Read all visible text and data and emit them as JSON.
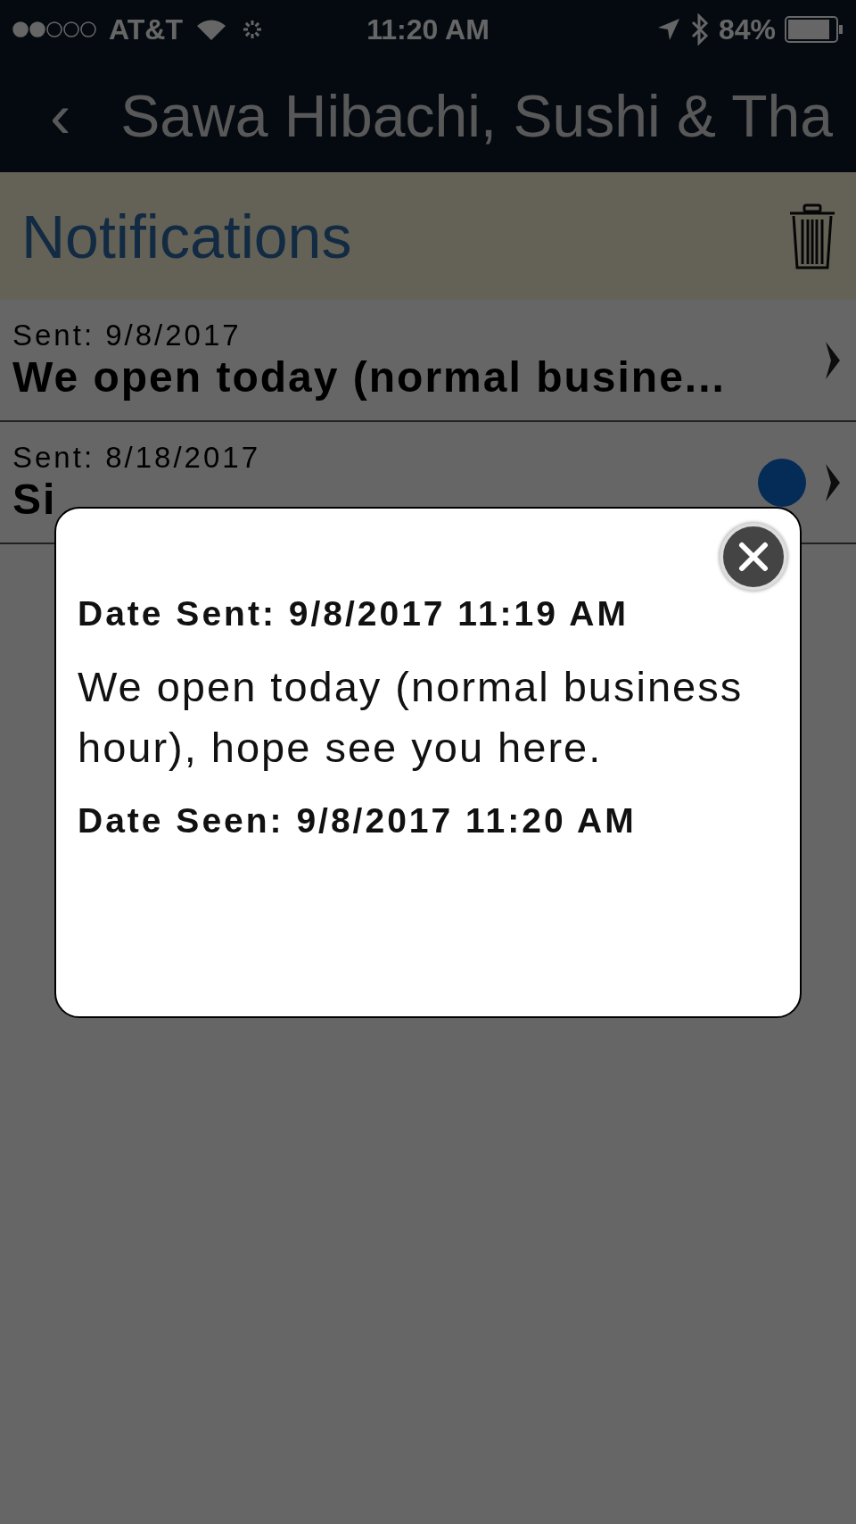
{
  "status_bar": {
    "carrier": "AT&T",
    "time": "11:20 AM",
    "battery": "84%"
  },
  "nav_bar": {
    "back_icon": "‹",
    "title": "Sawa Hibachi, Sushi & Tha"
  },
  "header": {
    "title": "Notifications"
  },
  "notifications": [
    {
      "sent": "Sent: 9/8/2017",
      "title": "We open today (normal busine...",
      "unread": false
    },
    {
      "sent": "Sent: 8/18/2017",
      "title": "Si",
      "unread": true
    }
  ],
  "dialog": {
    "date_sent": "Date Sent: 9/8/2017 11:19 AM",
    "message": "We open today (normal business hour), hope see you here.",
    "date_seen": "Date Seen: 9/8/2017 11:20 AM"
  }
}
